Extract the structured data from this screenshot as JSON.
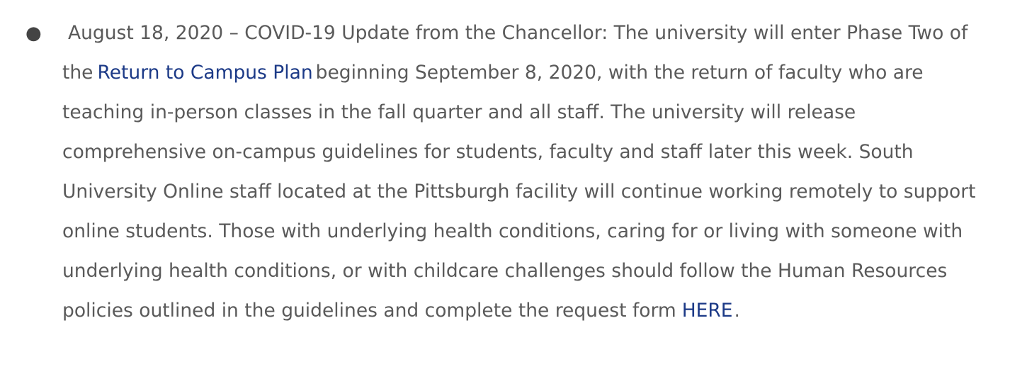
{
  "update": {
    "date_heading": "August 18, 2020 – COVID-19 Update from the Chancellor:",
    "text_1": "The university will enter Phase Two of the",
    "link_1": "Return to Campus Plan",
    "text_2": "beginning September 8, 2020, with the return of faculty who are teaching in-person classes in the fall quarter and all staff. The university will release comprehensive on-campus guidelines for students, faculty and staff later this week. South University Online staff located at the Pittsburgh facility will continue working remotely to support online students. Those with underlying health conditions, caring for or living with someone with underlying health conditions, or with childcare challenges should follow the Human Resources policies outlined in the guidelines and complete the request form",
    "link_2": "HERE",
    "text_end": "."
  },
  "colors": {
    "body_text": "#5a5a5a",
    "link": "#1c3a87",
    "bullet": "#444444"
  }
}
